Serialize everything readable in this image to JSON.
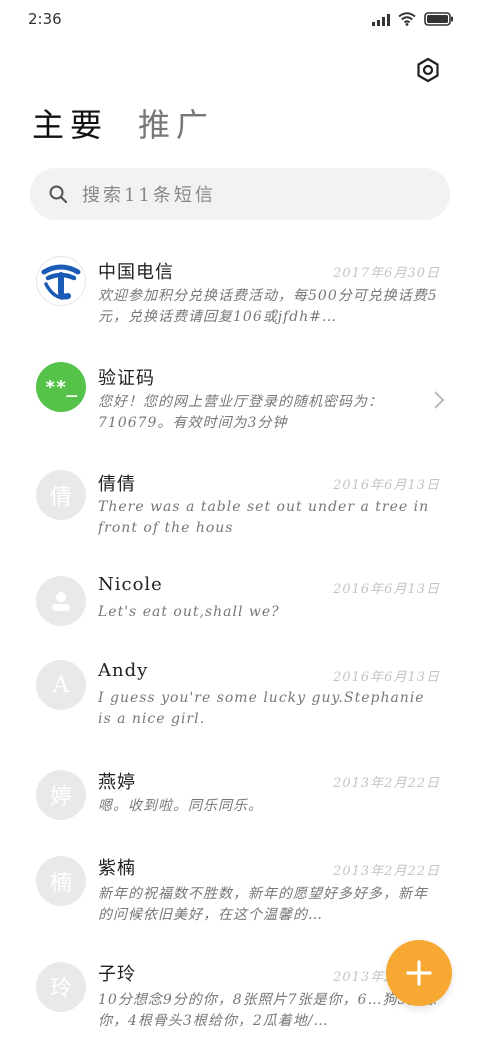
{
  "status": {
    "time": "2:36"
  },
  "icons": {
    "settings": "hexagon-settings-icon",
    "search": "search-icon",
    "chevron": "chevron-right-icon",
    "fab": "plus-icon",
    "contact": "person-icon"
  },
  "tabs": {
    "main": "主要",
    "promo": "推广"
  },
  "search": {
    "placeholder": "搜索11条短信"
  },
  "conversations": [
    {
      "name": "中国电信",
      "date": "2017年6月30日",
      "preview": "欢迎参加积分兑换话费活动，每500分可兑换话费5元，兑换话费请回复106或jfdh#…",
      "avatar_text": ""
    },
    {
      "name": "验证码",
      "date": "",
      "preview": "您好！您的网上营业厅登录的随机密码为：710679。有效时间为3分钟",
      "avatar_text": "**_"
    },
    {
      "name": "倩倩",
      "date": "2016年6月13日",
      "preview": "There was a table set out under a tree in front of the hous",
      "avatar_text": "倩"
    },
    {
      "name": "Nicole",
      "date": "2016年6月13日",
      "preview": "Let's eat out,shall we?",
      "avatar_text": ""
    },
    {
      "name": "Andy",
      "date": "2016年6月13日",
      "preview": "I guess you're some lucky guy.Stephanie is a nice girl.",
      "avatar_text": "A"
    },
    {
      "name": "燕婷",
      "date": "2013年2月22日",
      "preview": "嗯。收到啦。同乐同乐。",
      "avatar_text": "婷"
    },
    {
      "name": "紫楠",
      "date": "2013年2月22日",
      "preview": "新年的祝福数不胜数，新年的愿望好多好多，新年的问候依旧美好，在这个温馨的…",
      "avatar_text": "楠"
    },
    {
      "name": "子玲",
      "date": "2013年2月22日",
      "preview": "10分想念9分的你，8张照片7张是你，6…狗5只像你，4根骨头3根给你，2瓜着地/…",
      "avatar_text": "玲"
    }
  ],
  "colors": {
    "accent": "#f7a832",
    "green": "#55c24a",
    "telecom_blue": "#1a5bb8"
  }
}
